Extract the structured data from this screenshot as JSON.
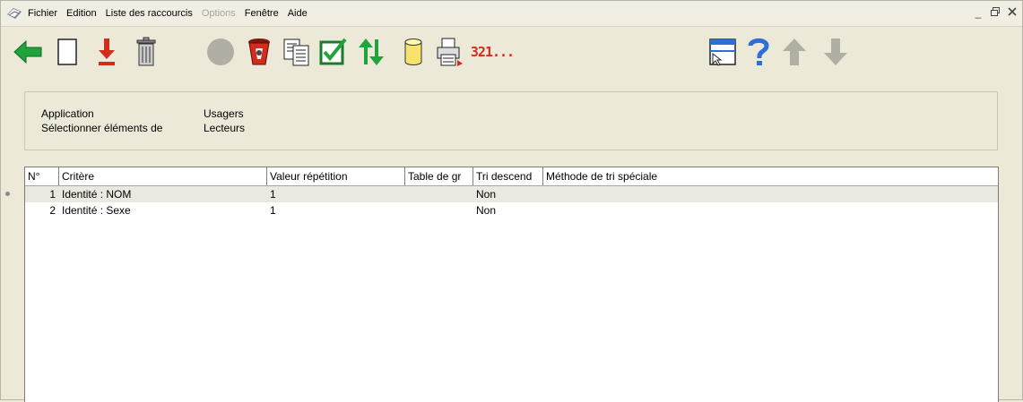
{
  "menu": {
    "items": [
      {
        "label": "Fichier",
        "enabled": true
      },
      {
        "label": "Edition",
        "enabled": true
      },
      {
        "label": "Liste des raccourcis",
        "enabled": true
      },
      {
        "label": "Options",
        "enabled": false
      },
      {
        "label": "Fenêtre",
        "enabled": true
      },
      {
        "label": "Aide",
        "enabled": true
      }
    ],
    "window_controls": {
      "minimize": "_",
      "restore": "🗗",
      "close": "✕"
    }
  },
  "toolbar": {
    "buttons": [
      "back-arrow-icon",
      "new-document-icon",
      "import-down-arrow-icon",
      "trash-icon",
      "disabled-circle-icon",
      "recycle-bin-icon",
      "copy-documents-icon",
      "checkbox-validate-icon",
      "sort-arrows-icon",
      "database-cylinder-icon",
      "printer-icon",
      "counter-icon",
      "window-layout-icon",
      "help-icon",
      "move-up-icon",
      "move-down-icon"
    ],
    "counter_label": "321..."
  },
  "selection": {
    "application_label": "Application",
    "application_value": "Usagers",
    "select_label": "Sélectionner éléments de",
    "select_value": "Lecteurs"
  },
  "grid": {
    "columns": [
      "N°",
      "Critère",
      "Valeur répétition",
      "Table de gr",
      "Tri descend",
      "Méthode de tri spéciale"
    ],
    "rows": [
      {
        "no": "1",
        "critere": "Identité : NOM",
        "valeur": "1",
        "table": "",
        "tri": "Non",
        "methode": ""
      },
      {
        "no": "2",
        "critere": "Identité : Sexe",
        "valeur": "1",
        "table": "",
        "tri": "Non",
        "methode": ""
      }
    ]
  },
  "colors": {
    "background": "#ece9d8",
    "green_icon": "#1fa33a",
    "red_icon": "#d42b1a",
    "blue_icon": "#2e6fd6",
    "disabled_icon": "#b1afa4"
  }
}
